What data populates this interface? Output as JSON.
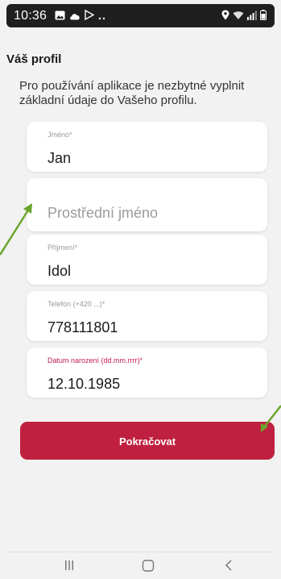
{
  "status_bar": {
    "time": "10:36",
    "icons_left": [
      "image-icon",
      "cloud-icon",
      "play-store-icon",
      "more-dots-icon"
    ],
    "icons_right": [
      "location-icon",
      "wifi-icon",
      "signal-icon",
      "battery-icon"
    ]
  },
  "profile": {
    "title": "Váš profil",
    "intro": "Pro používání aplikace je nezbytné vyplnit základní údaje do Vašeho profilu."
  },
  "fields": [
    {
      "label": "Jméno*",
      "value": "Jan"
    },
    {
      "placeholder": "Prostřední jméno"
    },
    {
      "label": "Příjmení*",
      "value": "Idol"
    },
    {
      "label": "Telefon (+420 ...)*",
      "value": "778111801"
    },
    {
      "label": "Datum narození (dd.mm.rrrr)*",
      "value": "12.10.1985",
      "focused": true
    }
  ],
  "continue_button": {
    "label": "Pokračovat"
  },
  "colors": {
    "accent": "#c0203f",
    "focus_label": "#c2185b",
    "annotation_arrow": "#6aa52e"
  },
  "nav_bar": {
    "icons": [
      "recent-apps-icon",
      "home-icon",
      "back-icon"
    ]
  }
}
